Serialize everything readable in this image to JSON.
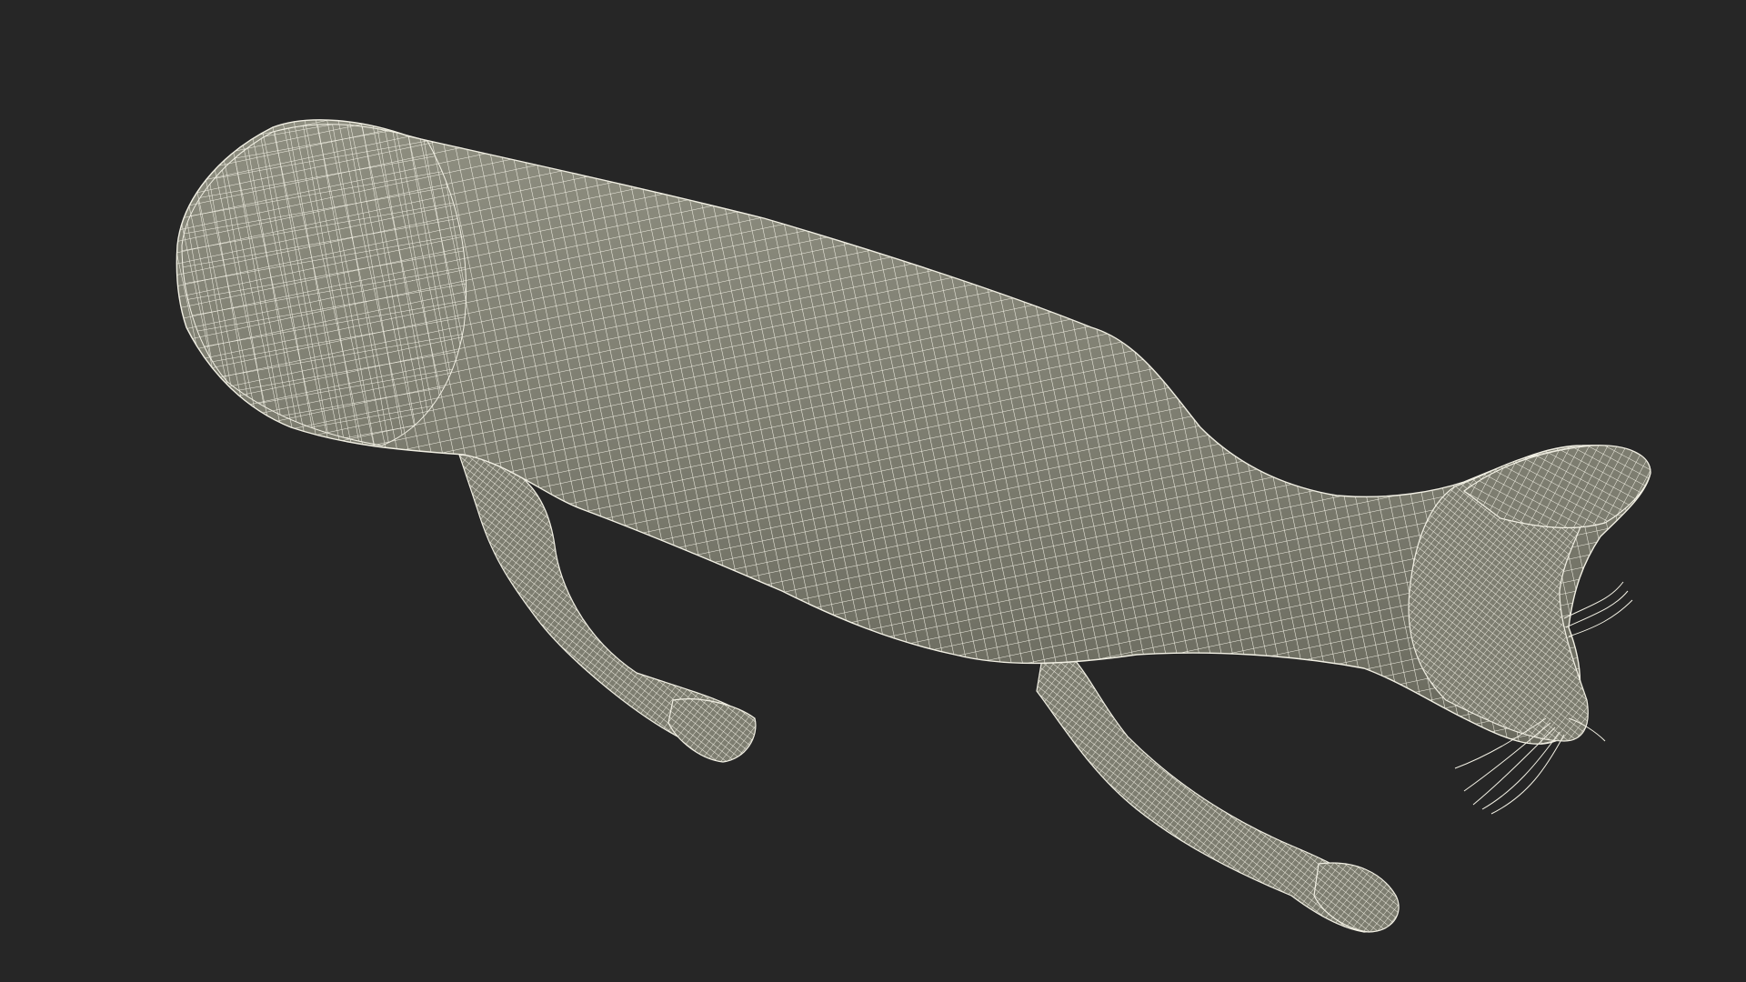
{
  "scene": {
    "subject": "wireframe-cat-model",
    "colors": {
      "background": "#262626",
      "surface": "#7d7d70",
      "surface_shadow": "#6a6a5e",
      "surface_highlight": "#8e8e80",
      "wire": "#f2f0e4"
    }
  }
}
